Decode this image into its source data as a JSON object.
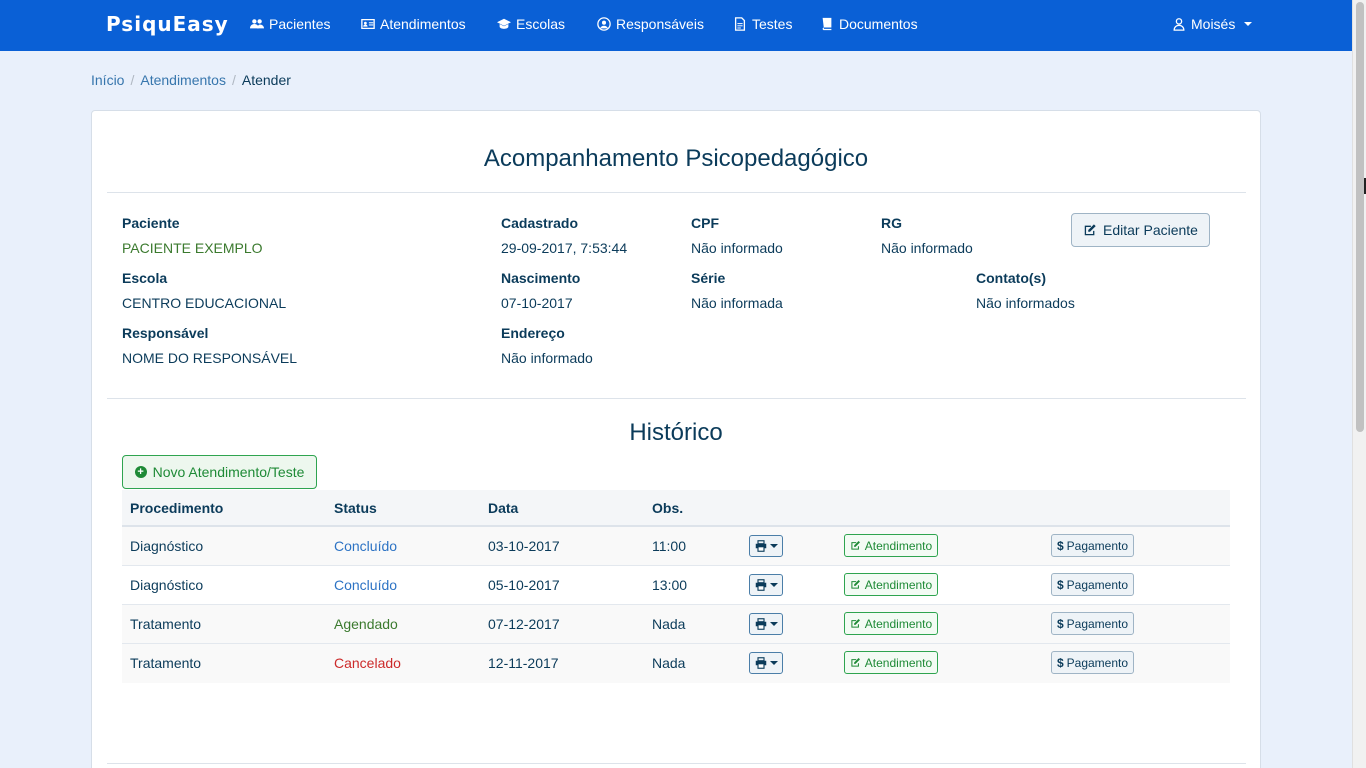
{
  "nav": {
    "brand": "PsiquEasy",
    "items": [
      {
        "label": "Pacientes",
        "icon": "users-icon"
      },
      {
        "label": "Atendimentos",
        "icon": "id-card-icon"
      },
      {
        "label": "Escolas",
        "icon": "graduation-cap-icon"
      },
      {
        "label": "Responsáveis",
        "icon": "user-circle-icon"
      },
      {
        "label": "Testes",
        "icon": "file-text-icon"
      },
      {
        "label": "Documentos",
        "icon": "book-icon"
      }
    ],
    "user": "Moisés"
  },
  "breadcrumb": {
    "home": "Início",
    "section": "Atendimentos",
    "current": "Atender"
  },
  "page": {
    "title": "Acompanhamento Psicopedagógico"
  },
  "patient": {
    "name_label": "Paciente",
    "name": "PACIENTE EXEMPLO",
    "registered_label": "Cadastrado",
    "registered": "29-09-2017, 7:53:44",
    "cpf_label": "CPF",
    "cpf": "Não informado",
    "rg_label": "RG",
    "rg": "Não informado",
    "school_label": "Escola",
    "school": "CENTRO EDUCACIONAL",
    "birth_label": "Nascimento",
    "birth": "07-10-2017",
    "grade_label": "Série",
    "grade": "Não informada",
    "contacts_label": "Contato(s)",
    "contacts": "Não informados",
    "guardian_label": "Responsável",
    "guardian": "NOME DO RESPONSÁVEL",
    "address_label": "Endereço",
    "address": "Não informado",
    "edit_button": "Editar Paciente"
  },
  "history": {
    "title": "Histórico",
    "new_button": "Novo Atendimento/Teste",
    "columns": {
      "procedure": "Procedimento",
      "status": "Status",
      "date": "Data",
      "obs": "Obs."
    },
    "atendimento_label": "Atendimento",
    "pagamento_label": "Pagamento",
    "rows": [
      {
        "procedure": "Diagnóstico",
        "status": "Concluído",
        "date": "03-10-2017",
        "obs": "11:00"
      },
      {
        "procedure": "Diagnóstico",
        "status": "Concluído",
        "date": "05-10-2017",
        "obs": "13:00"
      },
      {
        "procedure": "Tratamento",
        "status": "Agendado",
        "date": "07-12-2017",
        "obs": "Nada"
      },
      {
        "procedure": "Tratamento",
        "status": "Cancelado",
        "date": "12-11-2017",
        "obs": "Nada"
      }
    ]
  },
  "colors": {
    "navbar": "#0a60d6",
    "concluido": "#2d73c4",
    "agendado": "#3b7a2e",
    "cancelado": "#cc2a2a",
    "success": "#1e8a36"
  }
}
